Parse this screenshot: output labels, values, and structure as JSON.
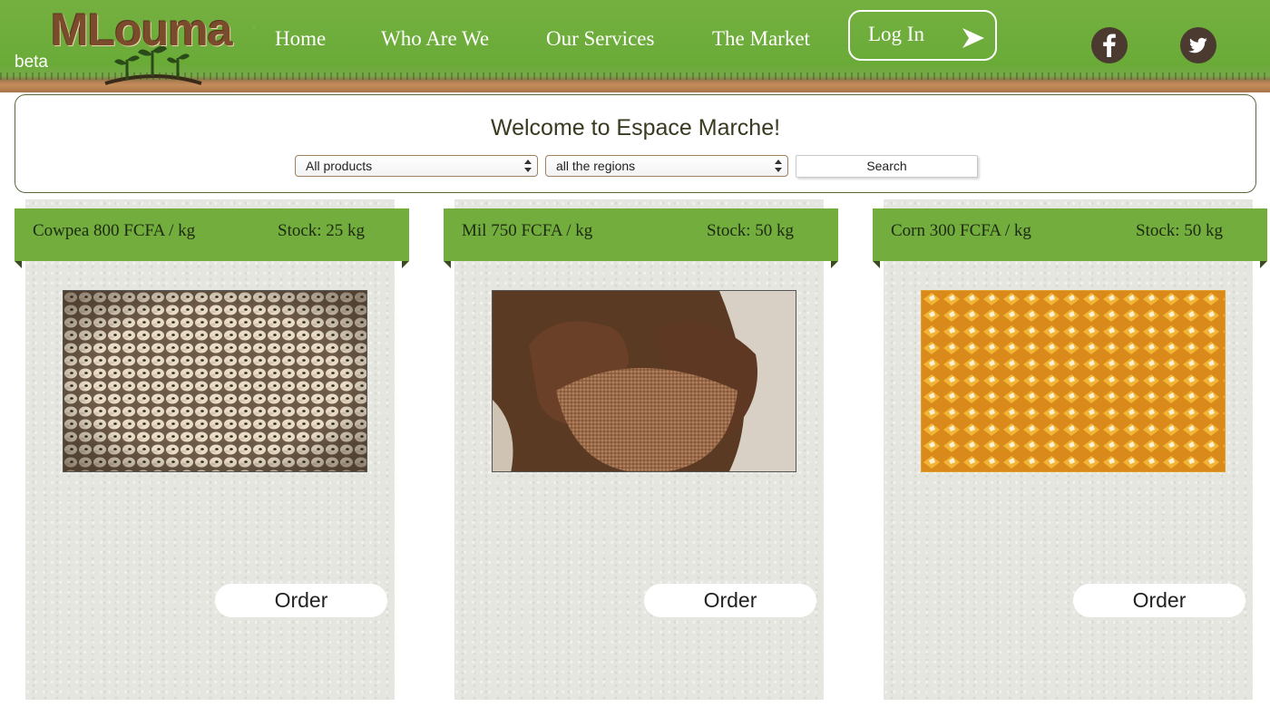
{
  "header": {
    "beta": "beta",
    "logo_text": "MLouma",
    "nav": [
      {
        "label": "Home"
      },
      {
        "label": "Who Are We"
      },
      {
        "label": "Our Services"
      },
      {
        "label": "The Market"
      }
    ],
    "login_label": "Log In",
    "social": [
      {
        "icon": "facebook-icon"
      },
      {
        "icon": "twitter-icon"
      }
    ]
  },
  "search": {
    "title": "Welcome to Espace Marche!",
    "product_select": "All products",
    "region_select": "all the regions",
    "button": "Search"
  },
  "products": [
    {
      "name": "Cowpea 800 FCFA / kg",
      "stock": "Stock: 25 kg",
      "image": "cowpea-beans-photo",
      "order": "Order"
    },
    {
      "name": "Mil 750 FCFA / kg",
      "stock": "Stock: 50 kg",
      "image": "millet-in-hands-photo",
      "order": "Order"
    },
    {
      "name": "Corn 300 FCFA / kg",
      "stock": "Stock: 50 kg",
      "image": "corn-kernels-photo",
      "order": "Order"
    }
  ],
  "colors": {
    "header_green": "#6aab38",
    "ribbon_green": "#72ad3e",
    "soil_brown": "#b08052"
  }
}
